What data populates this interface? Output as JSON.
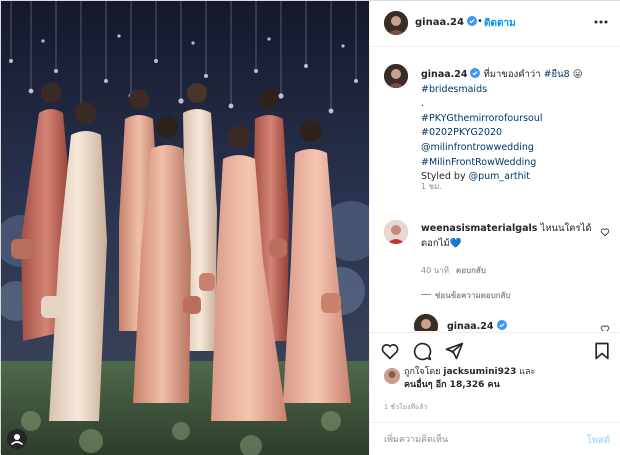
{
  "post": {
    "username": "ginaa.24",
    "follow_dot": "•",
    "follow_label": "ติดตาม",
    "caption": {
      "text_1": "ที่มาของคำว่า ",
      "tag_1": "#ยืน8",
      "emoji": " 😛",
      "tag_2": "#bridesmaids",
      "period": ".",
      "tag_3": "#PKYGthemirrorofoursoul",
      "tag_4": "#0202PKYG2020",
      "mention_1": "@milinfrontrowwedding",
      "tag_5": "#MilinFrontRowWedding",
      "styled_prefix": "Styled by ",
      "mention_2": "@pum_arthit",
      "time": "1 ชม."
    },
    "comments": [
      {
        "username": "weenasismaterialgals",
        "text": " ไหนนใครได้ดอกไม้",
        "emoji": "💙",
        "age": "40 นาที",
        "reply_label": "ตอบกลับ",
        "hide_replies": "ซ่อนข้อความตอบกลับ"
      },
      {
        "username": "ginaa.24"
      }
    ],
    "likes": {
      "prefix": "ถูกใจโดย ",
      "user": "jacksumini923",
      "mid": " และ ",
      "others_label": "คนอื่นๆ อีก 18,326 คน"
    },
    "posted_ago": "1 ชั่วโมงที่แล้ว",
    "add_comment_placeholder": "เพิ่มความคิดเห็น",
    "post_button": "โพสต์"
  },
  "icons": {
    "verified": "verified-badge-icon",
    "more": "more-options-icon",
    "like": "heart-icon",
    "comment": "comment-icon",
    "share": "share-icon",
    "save": "bookmark-icon",
    "tagged_user": "user-tag-icon"
  },
  "colors": {
    "link": "#00376b",
    "follow": "#0095f6",
    "muted": "#8e8e8e",
    "post_disabled": "#b2dffc"
  }
}
